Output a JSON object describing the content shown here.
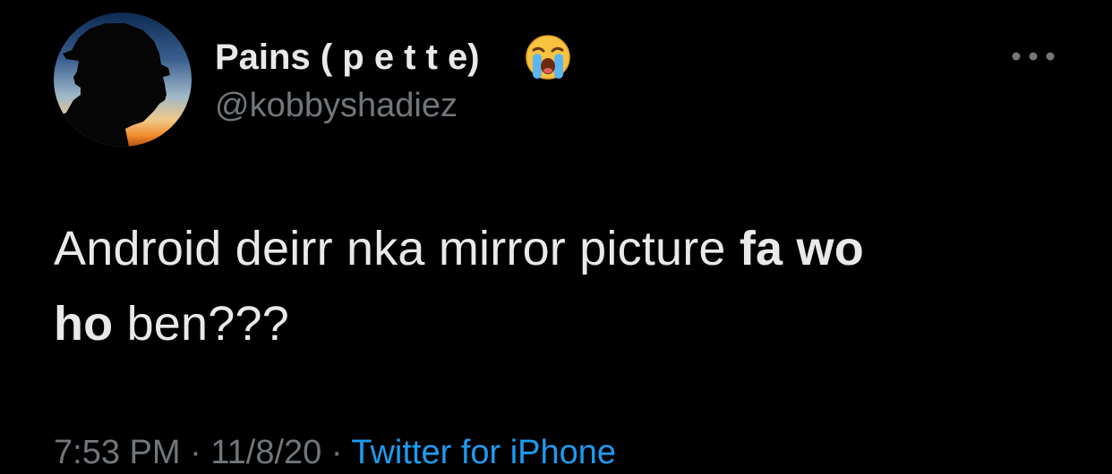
{
  "author": {
    "display_name": "Pains ( p e t t e)",
    "handle": "@kobbyshadiez",
    "emoji_icon": "loudly-crying-face-emoji",
    "avatar": "silhouette-sunset-avatar"
  },
  "tweet": {
    "text_1": "Android deirr nka mirror picture ",
    "bold_1": "fa wo",
    "bold_2": "ho",
    "text_2": " ben???"
  },
  "meta": {
    "time": "7:53 PM",
    "date": "11/8/20",
    "separator": " · ",
    "source": "Twitter for iPhone"
  },
  "icons": {
    "more": "more-horizontal-icon"
  },
  "colors": {
    "background": "#000000",
    "text_primary": "#e7e9ea",
    "text_secondary": "#71767b",
    "link": "#1d9bf0"
  }
}
